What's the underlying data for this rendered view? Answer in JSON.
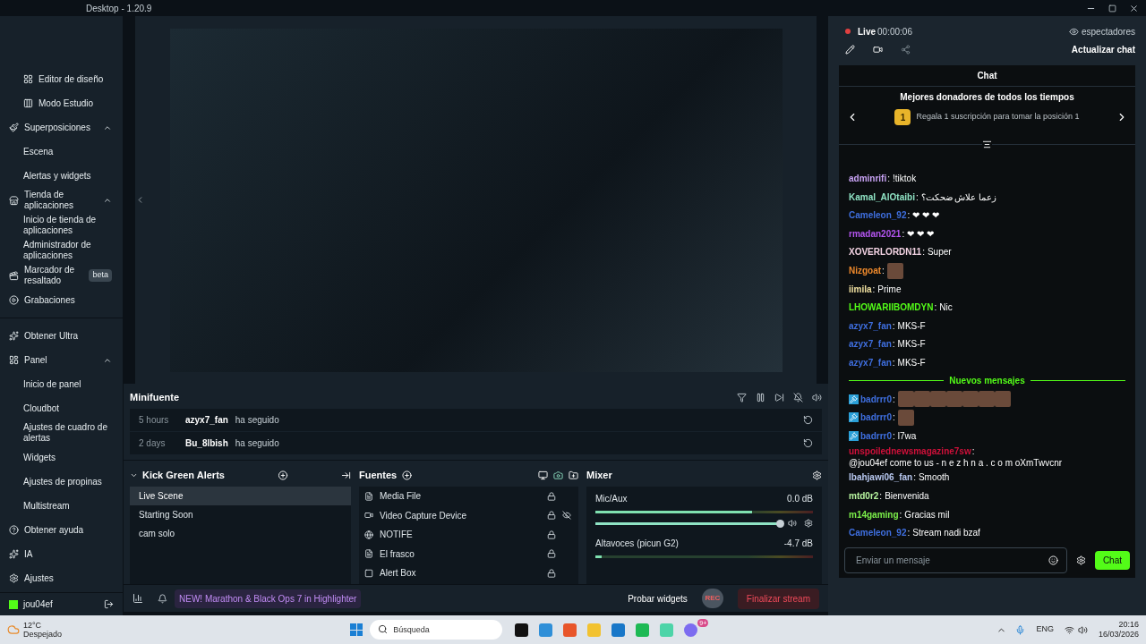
{
  "window": {
    "title": "Desktop - 1.20.9"
  },
  "sidebar": {
    "items": [
      {
        "label": "Editor de diseño",
        "kind": "tool"
      },
      {
        "label": "Modo Estudio",
        "kind": "tool"
      },
      {
        "label": "Superposiciones",
        "kind": "group",
        "expanded": true,
        "children": [
          {
            "label": "Escena"
          },
          {
            "label": "Alertas y widgets"
          }
        ]
      },
      {
        "label": "Tienda de aplicaciones",
        "kind": "group",
        "expanded": true,
        "children": [
          {
            "label": "Inicio de tienda de aplicaciones"
          },
          {
            "label": "Administrador de aplicaciones"
          }
        ]
      },
      {
        "label": "Marcador de resaltado",
        "kind": "link",
        "badge": "beta"
      },
      {
        "label": "Grabaciones",
        "kind": "link"
      },
      {
        "kind": "divider"
      },
      {
        "label": "Obtener Ultra",
        "kind": "link"
      },
      {
        "label": "Panel",
        "kind": "group",
        "expanded": true,
        "children": [
          {
            "label": "Inicio de panel"
          },
          {
            "label": "Cloudbot"
          },
          {
            "label": "Ajustes de cuadro de alertas"
          },
          {
            "label": "Widgets"
          },
          {
            "label": "Ajustes de propinas"
          },
          {
            "label": "Multistream"
          }
        ]
      },
      {
        "label": "Obtener ayuda",
        "kind": "link"
      },
      {
        "label": "IA",
        "kind": "link"
      },
      {
        "label": "Ajustes",
        "kind": "link"
      }
    ],
    "user": "jou04ef"
  },
  "minifeed": {
    "title": "Minifuente",
    "events": [
      {
        "time": "5 hours",
        "user": "azyx7_fan",
        "action": "ha seguido"
      },
      {
        "time": "2 days",
        "user": "Bu_8lbish",
        "action": "ha seguido"
      }
    ]
  },
  "scenes": {
    "title": "Kick Green Alerts",
    "items": [
      {
        "label": "Live Scene",
        "selected": true
      },
      {
        "label": "Starting Soon",
        "selected": false
      },
      {
        "label": "cam solo",
        "selected": false
      }
    ]
  },
  "sources": {
    "title": "Fuentes",
    "items": [
      {
        "label": "Media File",
        "hidden": false
      },
      {
        "label": "Video Capture Device",
        "hidden": true
      },
      {
        "label": "NOTIFE",
        "hidden": false
      },
      {
        "label": "El frasco",
        "hidden": false
      },
      {
        "label": "Alert Box",
        "hidden": false
      }
    ]
  },
  "mixer": {
    "title": "Mixer",
    "channels": [
      {
        "name": "Mic/Aux",
        "reading": "0.0 dB",
        "meter": {
          "level": 0.72
        },
        "volume": {
          "level": 1
        }
      },
      {
        "name": "Altavoces (picun G2)",
        "reading": "-4.7 dB",
        "meter": {
          "level": 0.03
        }
      }
    ]
  },
  "footer": {
    "announcement": "NEW! Marathon & Black Ops 7 in Highlighter",
    "test_widgets": "Probar widgets",
    "rec": "REC",
    "end_stream": "Finalizar stream"
  },
  "stream": {
    "live": "Live",
    "timer": "00:00:06",
    "viewers": "espectadores",
    "refresh_chat": "Actualizar chat"
  },
  "chat": {
    "title": "Chat",
    "donors_title": "Mejores donadores de todos los tiempos",
    "rank": "1",
    "donors_text": "Regala 1 suscripción para tomar la posición 1",
    "messages": [
      {
        "kind": "message",
        "user": "adminrifi",
        "color": "#c9a3f5",
        "parts": [
          {
            "kind": "text",
            "text": "!tiktok"
          }
        ]
      },
      {
        "kind": "message",
        "user": "Kamal_AlOtaibi",
        "color": "#8fe3c4",
        "parts": [
          {
            "kind": "text",
            "text": "زعما علاش ضحكت؟"
          }
        ]
      },
      {
        "kind": "message",
        "user": "Cameleon_92",
        "color": "#3f6fe0",
        "parts": [
          {
            "kind": "text",
            "text": "❤ ❤ ❤"
          }
        ]
      },
      {
        "kind": "message",
        "user": "rmadan2021",
        "color": "#b455f0",
        "parts": [
          {
            "kind": "text",
            "text": "❤ ❤ ❤"
          }
        ]
      },
      {
        "kind": "message",
        "user": "XOVERLORDN11",
        "color": "#f3d3e3",
        "parts": [
          {
            "kind": "text",
            "text": "Super"
          }
        ]
      },
      {
        "kind": "message",
        "user": "Nizgoat",
        "color": "#f08a2c",
        "parts": [
          {
            "kind": "emote"
          }
        ]
      },
      {
        "kind": "message",
        "user": "iimila",
        "color": "#f0e0a0",
        "parts": [
          {
            "kind": "text",
            "text": "Prime"
          }
        ]
      },
      {
        "kind": "message",
        "user": "LHOWARIIBOMDYN",
        "color": "#53fc18",
        "parts": [
          {
            "kind": "text",
            "text": "Nic"
          }
        ]
      },
      {
        "kind": "message",
        "user": "azyx7_fan",
        "color": "#3f6fe0",
        "parts": [
          {
            "kind": "text",
            "text": "MKS-F"
          }
        ]
      },
      {
        "kind": "message",
        "user": "azyx7_fan",
        "color": "#3f6fe0",
        "parts": [
          {
            "kind": "text",
            "text": "MKS-F"
          }
        ]
      },
      {
        "kind": "message",
        "user": "azyx7_fan",
        "color": "#3f6fe0",
        "parts": [
          {
            "kind": "text",
            "text": "MKS-F"
          }
        ]
      },
      {
        "kind": "divider",
        "text": "Nuevos mensajes"
      },
      {
        "kind": "message",
        "user": "badrrr0",
        "color": "#3f6fe0",
        "moderator": true,
        "parts": [
          {
            "kind": "emote"
          },
          {
            "kind": "emote"
          },
          {
            "kind": "emote"
          },
          {
            "kind": "emote"
          },
          {
            "kind": "emote"
          },
          {
            "kind": "emote"
          },
          {
            "kind": "emote"
          }
        ]
      },
      {
        "kind": "message",
        "user": "badrrr0",
        "color": "#3f6fe0",
        "moderator": true,
        "parts": [
          {
            "kind": "emote"
          }
        ]
      },
      {
        "kind": "message",
        "user": "badrrr0",
        "color": "#3f6fe0",
        "moderator": true,
        "parts": [
          {
            "kind": "text",
            "text": "l7wa"
          }
        ]
      },
      {
        "kind": "message",
        "user": "unspoilednewsmagazine7sw",
        "color": "#d0103a",
        "parts": [
          {
            "kind": "text",
            "text": "@jou04ef come to us - n e z h n a . c o m oXmTwvcnr"
          }
        ]
      },
      {
        "kind": "message",
        "user": "lbahjawi06_fan",
        "color": "#b8c8f0",
        "parts": [
          {
            "kind": "text",
            "text": "Smooth"
          }
        ]
      },
      {
        "kind": "message",
        "user": "mtd0r2",
        "color": "#b8f5a0",
        "parts": [
          {
            "kind": "text",
            "text": "Bienvenida"
          }
        ]
      },
      {
        "kind": "message",
        "user": "m14gaming",
        "color": "#7cf04a",
        "parts": [
          {
            "kind": "text",
            "text": "Gracias mil"
          }
        ]
      },
      {
        "kind": "message",
        "user": "Cameleon_92",
        "color": "#3f6fe0",
        "parts": [
          {
            "kind": "text",
            "text": "Stream nadi bzaf"
          }
        ]
      }
    ],
    "separator": ":",
    "placeholder": "Enviar un mensaje",
    "send": "Chat"
  },
  "taskbar": {
    "temperature": "12°C",
    "weather": "Despejado",
    "search_placeholder": "Búsqueda",
    "notification_badge": "9+",
    "language": "ENG",
    "time": "20:16",
    "date": "16/03/2026"
  }
}
